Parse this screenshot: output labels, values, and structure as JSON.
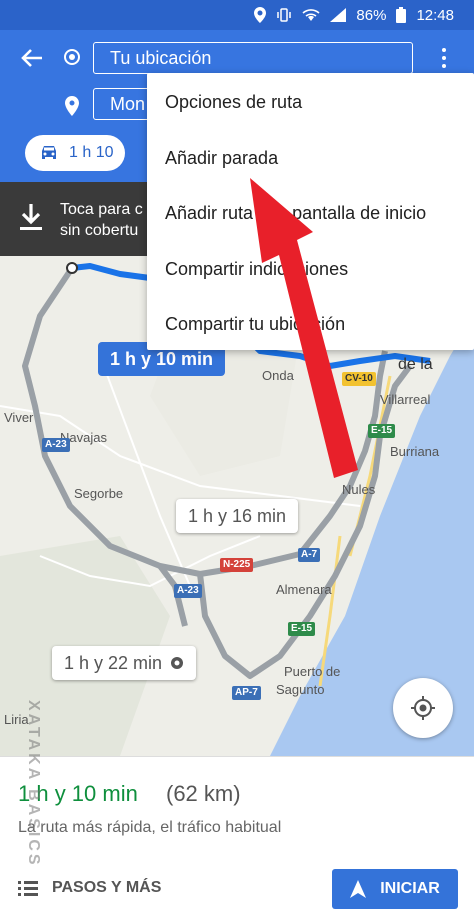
{
  "status_bar": {
    "battery": "86%",
    "time": "12:48"
  },
  "directions": {
    "origin": "Tu ubicación",
    "destination": "Mon",
    "mode_time": "1 h 10"
  },
  "banner": {
    "line1": "Toca para c",
    "line2": "sin cobertu"
  },
  "menu": {
    "items": [
      "Opciones de ruta",
      "Añadir parada",
      "Añadir ruta a la pantalla de inicio",
      "Compartir indicaciones",
      "Compartir tu ubicación"
    ]
  },
  "map": {
    "route_times": {
      "selected": "1 h y 10 min",
      "alt1": "1 h y 16 min",
      "alt2": "1 h y 22 min"
    },
    "places": [
      "Onda",
      "de la",
      "Villarreal",
      "Burriana",
      "Viver",
      "Navajas",
      "Segorbe",
      "Nules",
      "Almenara",
      "Puerto de",
      "Sagunto",
      "Liria"
    ],
    "shields": [
      "CV-10",
      "E-15",
      "A-23",
      "N-225",
      "A-7",
      "A-23",
      "E-15",
      "AP-7"
    ]
  },
  "summary": {
    "duration": "1 h y 10 min",
    "distance": "(62 km)",
    "description": "La ruta más rápida, el tráfico habitual",
    "steps_label": "PASOS Y MÁS",
    "start_label": "INICIAR"
  },
  "watermark": "XATAKA BASICS",
  "colors": {
    "header": "#3775e0",
    "status": "#2b63c9",
    "accent": "#3473d9",
    "green": "#0f8f3d",
    "arrow": "#e8202a"
  }
}
